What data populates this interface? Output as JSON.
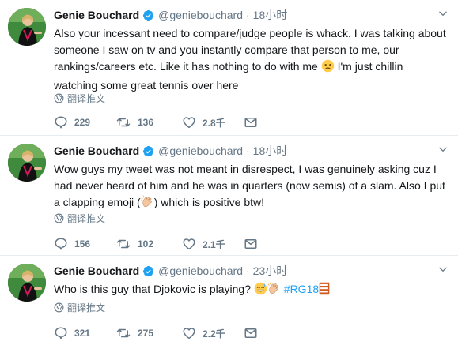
{
  "tweets": [
    {
      "name": "Genie Bouchard",
      "handle": "@geniebouchard",
      "separator": "·",
      "time": "18小时",
      "text_before_emoji": "Also your incessant need to compare/judge people is whack. I was talking about someone I saw on tv and you instantly compare that person to me, our rankings/careers etc. Like it has nothing to do with me ",
      "text_after_emoji": " I'm just chillin watching some great tennis over here",
      "emoji_name": "slightly-frowning-face",
      "translate": "翻译推文",
      "replies": "229",
      "retweets": "136",
      "likes": "2.8千"
    },
    {
      "name": "Genie Bouchard",
      "handle": "@geniebouchard",
      "separator": "·",
      "time": "18小时",
      "text_before_emoji": "Wow guys my tweet was not meant in disrespect, I was genuinely asking cuz I had never heard of him and he was in quarters (now semis) of a slam. Also I put a clapping emoji (",
      "text_after_emoji": ") which is positive btw!",
      "emoji_name": "clapping-hands",
      "translate": "翻译推文",
      "replies": "156",
      "retweets": "102",
      "likes": "2.1千"
    },
    {
      "name": "Genie Bouchard",
      "handle": "@geniebouchard",
      "separator": "·",
      "time": "23小时",
      "text_before_emoji": "Who is this guy that Djokovic is playing? ",
      "hashtag": "#RG18",
      "emoji_names": [
        "grinning-sweat-face",
        "clapping-hands",
        "roland-garros-emoji"
      ],
      "translate": "翻译推文",
      "replies": "321",
      "retweets": "275",
      "likes": "2.2千"
    }
  ],
  "colors": {
    "text": "#14171a",
    "secondary": "#657786",
    "link": "#1da1f2",
    "divider": "#e6ecf0",
    "verified": "#1da1f2"
  }
}
